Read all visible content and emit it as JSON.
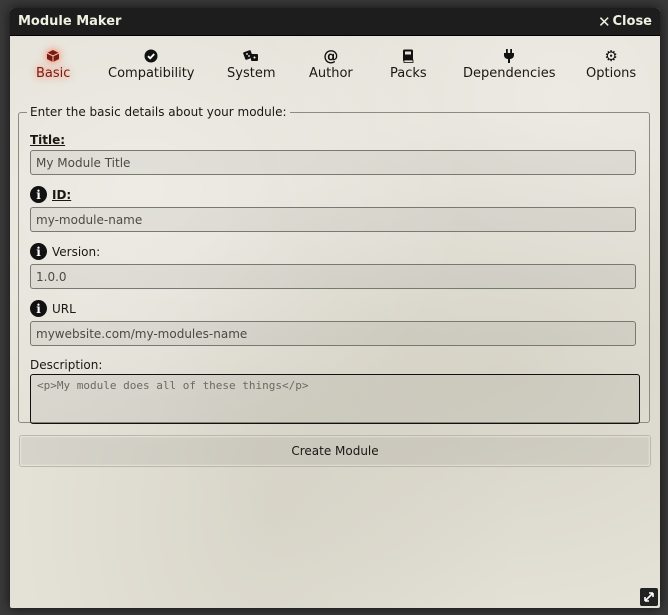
{
  "window": {
    "title": "Module Maker",
    "close_label": "Close"
  },
  "tabs": [
    {
      "label": "Basic",
      "icon": "cube-icon",
      "active": true
    },
    {
      "label": "Compatibility",
      "icon": "check-circle-icon",
      "active": false
    },
    {
      "label": "System",
      "icon": "dice-icon",
      "active": false
    },
    {
      "label": "Author",
      "icon": "at-icon",
      "active": false
    },
    {
      "label": "Packs",
      "icon": "book-icon",
      "active": false
    },
    {
      "label": "Dependencies",
      "icon": "plug-icon",
      "active": false
    },
    {
      "label": "Options",
      "icon": "gear-icon",
      "active": false
    }
  ],
  "form": {
    "legend": "Enter the basic details about your module:",
    "title_label": "Title:",
    "title_placeholder": "My Module Title",
    "id_label": "ID:",
    "id_placeholder": "my-module-name",
    "version_label": "Version:",
    "version_placeholder": "1.0.0",
    "url_label": "URL",
    "url_placeholder": "mywebsite.com/my-modules-name",
    "description_label": "Description:",
    "description_placeholder": "<p>My module does all of these things</p>"
  },
  "actions": {
    "create_label": "Create Module"
  },
  "colors": {
    "titlebar": "#1d1d1d",
    "panel": "#e4e1d7",
    "active_tab": "#7a1b12",
    "active_glow": "#ff6b4a"
  }
}
